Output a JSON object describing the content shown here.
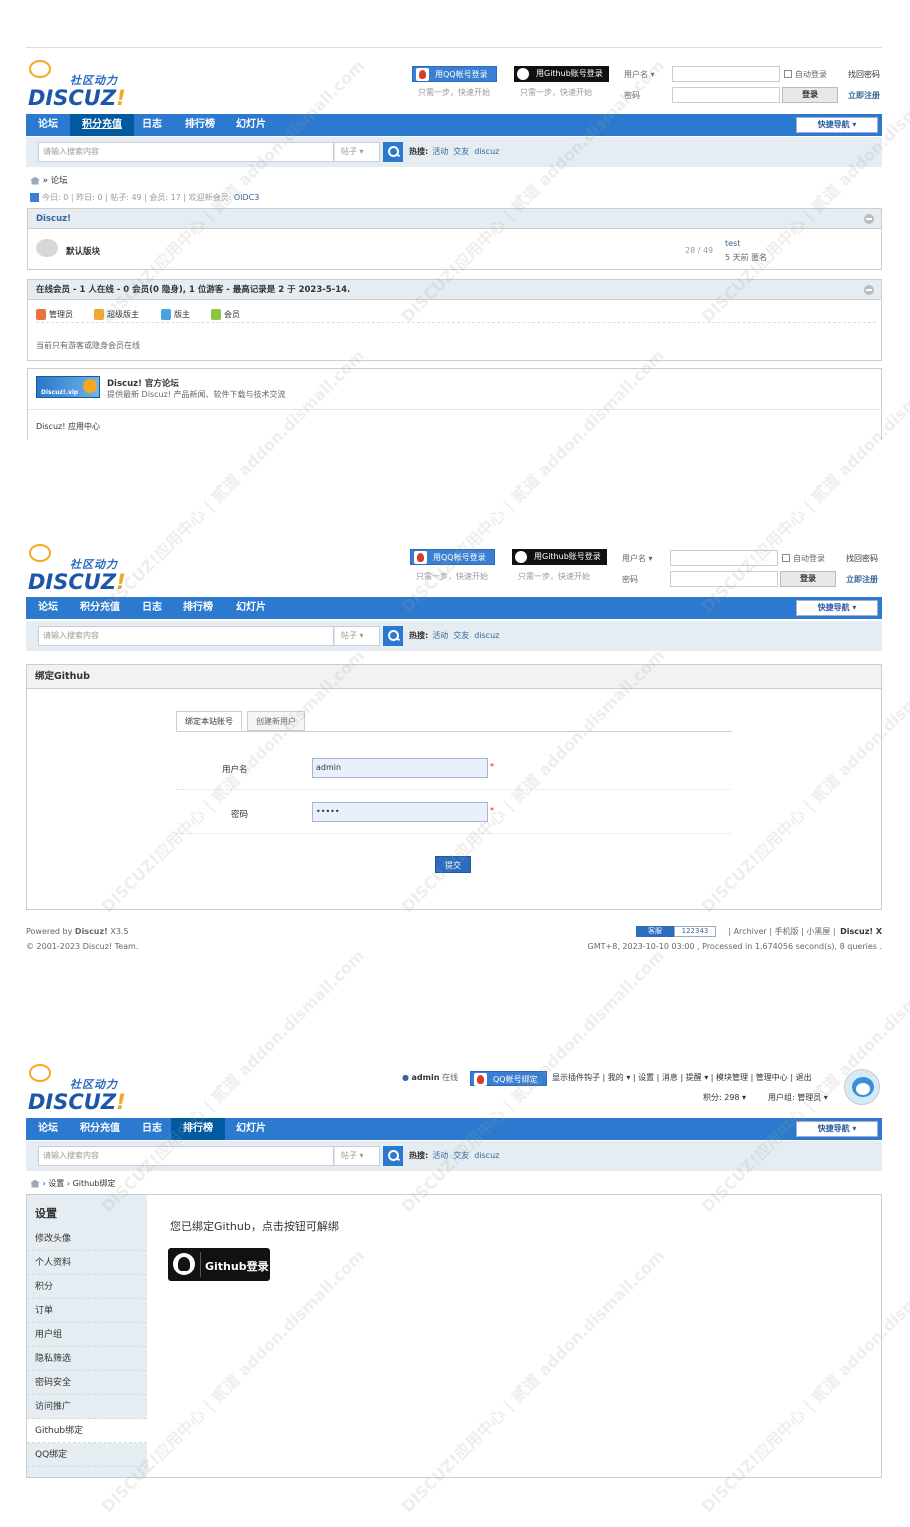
{
  "logo": {
    "slogan": "社区动力",
    "word_a": "DISCUZ",
    "word_b": "!"
  },
  "login": {
    "qq_button": "用QQ帐号登录",
    "github_button": "用Github账号登录",
    "qq_hint": "只需一步，快速开始",
    "github_hint": "只需一步，快速开始",
    "username_label": "用户名 ▾",
    "password_label": "密码",
    "auto_login": "自动登录",
    "find_password": "找回密码",
    "login_button": "登录",
    "register": "立即注册"
  },
  "nav": {
    "items": [
      "论坛",
      "积分充值",
      "日志",
      "排行榜",
      "幻灯片"
    ],
    "quick_nav": "快捷导航 ▾"
  },
  "search": {
    "placeholder": "请输入搜索内容",
    "type": "帖子 ▾",
    "hot_label": "热搜:",
    "hot_terms": [
      "活动",
      "交友",
      "discuz"
    ]
  },
  "section1": {
    "breadcrumb": "» 论坛",
    "stats_text": "今日: 0 | 昨日: 0 | 帖子: 49 | 会员: 17 | 欢迎新会员: ",
    "newest_member": "OIDC3",
    "category_title": "Discuz!",
    "forum_name": "默认版块",
    "forum_counts": "28 / 49",
    "last_post_user": "test",
    "last_post_info": "5 天前 匿名",
    "online_title": "在线会员 - 1 人在线 - 0 会员(0 隐身), 1 位游客 - 最高记录是 2 于 2023-5-14.",
    "legend": [
      "管理员",
      "超级版主",
      "版主",
      "会员"
    ],
    "online_note": "当前只有游客或隐身会员在线",
    "official_badge": "Discuz!.vip",
    "official_title": "Discuz! 官方论坛",
    "official_desc": "提供最新 Discuz! 产品新闻、软件下载与技术交流",
    "app_center": "Discuz! 应用中心"
  },
  "section2": {
    "box_title": "绑定Github",
    "tab_bind": "绑定本站账号",
    "tab_create": "创建新用户",
    "username_label": "用户名",
    "username_value": "admin",
    "password_label": "密码",
    "password_value": "•••••",
    "required_mark": "*",
    "submit": "提交",
    "footer_powered": "Powered by ",
    "footer_brand": "Discuz!",
    "footer_version": " X3.5",
    "footer_copy": "© 2001-2023 Discuz! Team.",
    "footer_service": "客服",
    "footer_service_num": "122343",
    "footer_links": "| Archiver | 手机版 | 小黑屋 |",
    "footer_brand_r": "Discuz! X",
    "footer_time": "GMT+8, 2023-10-10 03:00 , Processed in 1.674056 second(s), 8 queries ."
  },
  "section3": {
    "user_name": "admin",
    "user_status": "在线",
    "qq_bind": "QQ帐号绑定",
    "top_links": "显示插件钩子 | 我的 ▾ | 设置 | 消息 | 提醒 ▾ | 模块管理 | 管理中心 | 退出",
    "credits": "积分: 298 ▾",
    "user_group": "用户组: 管理员 ▾",
    "breadcrumb": "› 设置 › Github绑定",
    "side_title": "设置",
    "side_items": [
      "修改头像",
      "个人资料",
      "积分",
      "订单",
      "用户组",
      "隐私筛选",
      "密码安全",
      "访问推广",
      "Github绑定",
      "QQ绑定"
    ],
    "bound_message": "您已绑定Github，点击按钮可解绑",
    "github_login": "Github登录"
  },
  "watermark": "DISCUZ!应用中心 | 贰道 addon.dismall.com",
  "colors": {
    "nav": "#2b7acf",
    "nav_active": "#005aa0",
    "search_bg": "#e5edf2",
    "link": "#336699"
  }
}
